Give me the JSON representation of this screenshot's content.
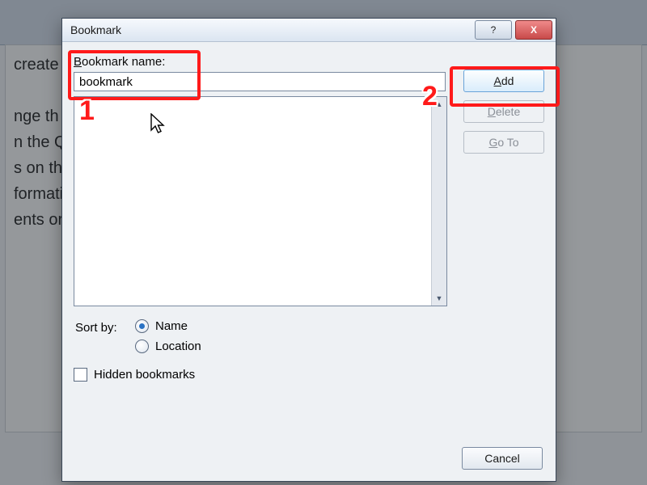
{
  "dialog": {
    "title": "Bookmark",
    "name_label": "Bookmark name:",
    "name_value": "bookmark",
    "add_label": "Add",
    "delete_label": "Delete",
    "goto_label": "Go To",
    "sort_label": "Sort by:",
    "sort_name": "Name",
    "sort_location": "Location",
    "hidden_label": "Hidden bookmarks",
    "cancel_label": "Cancel",
    "help_label": "?",
    "close_label": "X"
  },
  "background": {
    "text": "create\n\nnge th                                                                                               look for\nn the Q                                                                                              ectly by u\ns on the                                                                                             he curre\nformati                                                                                             ument, c\nents or                                                                                              Style gal"
  },
  "callouts": {
    "one": "1",
    "two": "2"
  }
}
